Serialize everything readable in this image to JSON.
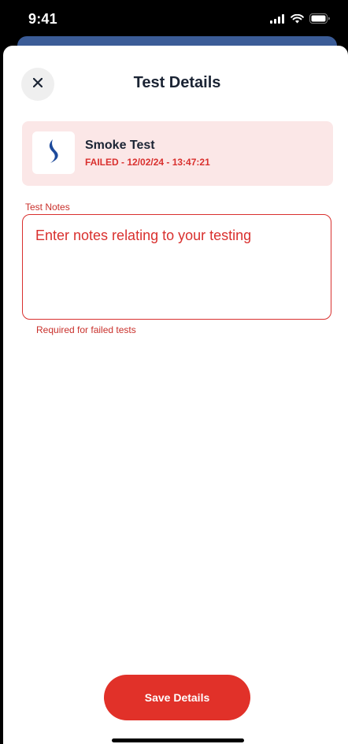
{
  "status_bar": {
    "time": "9:41",
    "icons": [
      "signal-icon",
      "wifi-icon",
      "battery-icon"
    ]
  },
  "header": {
    "title": "Test Details",
    "close_icon": "close-icon"
  },
  "test": {
    "name": "Smoke Test",
    "status_text": "FAILED - 12/02/24 - 13:47:21",
    "logo_icon": "smoke-icon"
  },
  "notes": {
    "label": "Test Notes",
    "placeholder": "Enter notes relating to your testing",
    "value": "",
    "helper": "Required for failed tests"
  },
  "actions": {
    "save_label": "Save Details"
  },
  "colors": {
    "accent": "#e13129",
    "error": "#d9302e",
    "card_bg": "#fbe7e7",
    "header_blue": "#3b5c97",
    "logo_blue": "#1d4a9b"
  }
}
